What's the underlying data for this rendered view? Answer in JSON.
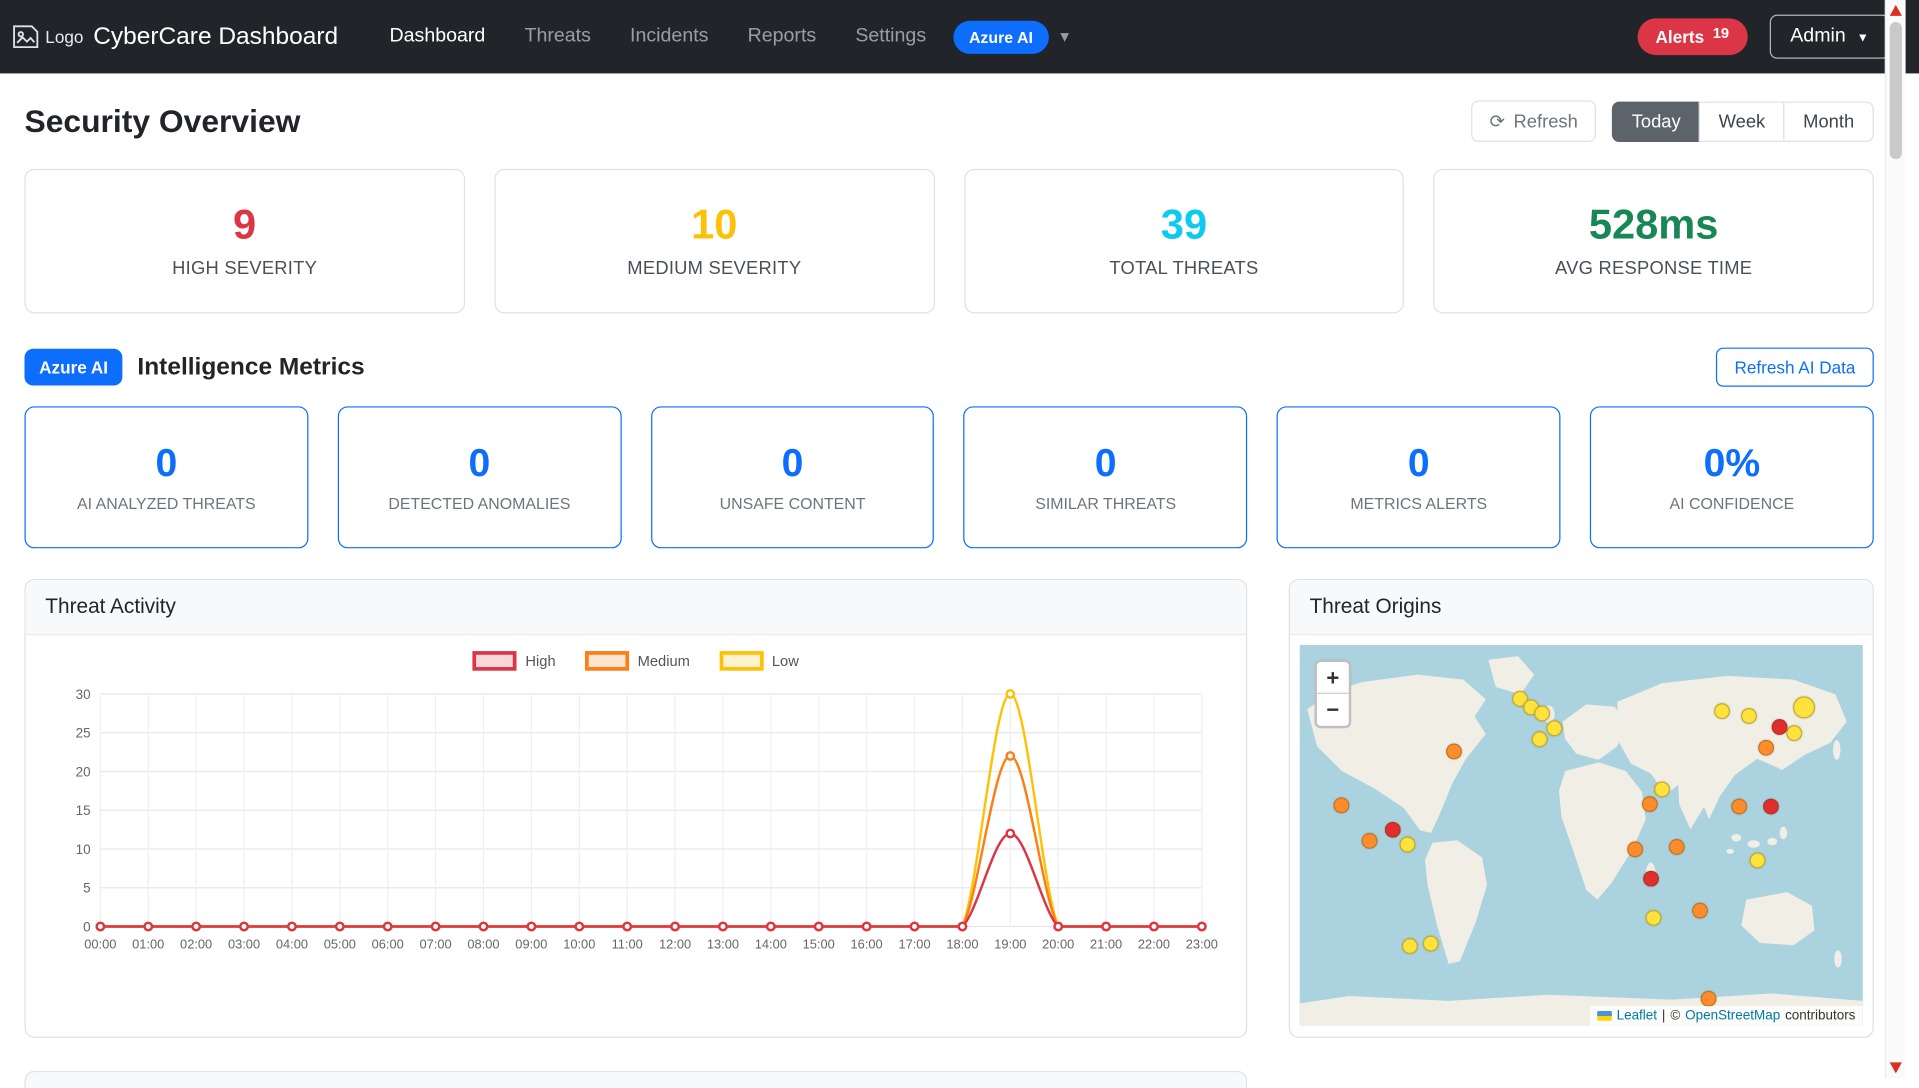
{
  "navbar": {
    "logo_text": "Logo",
    "brand": "CyberCare Dashboard",
    "items": [
      {
        "label": "Dashboard",
        "active": true
      },
      {
        "label": "Threats",
        "active": false
      },
      {
        "label": "Incidents",
        "active": false
      },
      {
        "label": "Reports",
        "active": false
      },
      {
        "label": "Settings",
        "active": false
      }
    ],
    "azure_badge": "Azure AI",
    "alerts": {
      "label": "Alerts",
      "count": "19"
    },
    "admin_label": "Admin"
  },
  "icons": {
    "refresh": "⟳",
    "caret_small": "▼",
    "caret_nav": "▼"
  },
  "page": {
    "title": "Security Overview",
    "refresh_label": "Refresh",
    "ranges": [
      {
        "label": "Today",
        "active": true
      },
      {
        "label": "Week",
        "active": false
      },
      {
        "label": "Month",
        "active": false
      }
    ]
  },
  "stats": [
    {
      "value": "9",
      "label": "HIGH SEVERITY",
      "color": "#dc3545"
    },
    {
      "value": "10",
      "label": "MEDIUM SEVERITY",
      "color": "#ffc107"
    },
    {
      "value": "39",
      "label": "TOTAL THREATS",
      "color": "#0dcaf0"
    },
    {
      "value": "528ms",
      "label": "AVG RESPONSE TIME",
      "color": "#198754"
    }
  ],
  "ai": {
    "badge": "Azure AI",
    "title": "Intelligence Metrics",
    "refresh_label": "Refresh AI Data",
    "accent": "#0d6efd",
    "metrics": [
      {
        "value": "0",
        "label": "AI ANALYZED THREATS"
      },
      {
        "value": "0",
        "label": "DETECTED ANOMALIES"
      },
      {
        "value": "0",
        "label": "UNSAFE CONTENT"
      },
      {
        "value": "0",
        "label": "SIMILAR THREATS"
      },
      {
        "value": "0",
        "label": "METRICS ALERTS"
      },
      {
        "value": "0%",
        "label": "AI CONFIDENCE"
      }
    ]
  },
  "activity_card": {
    "title": "Threat Activity"
  },
  "chart_data": {
    "type": "line",
    "x": [
      "00:00",
      "01:00",
      "02:00",
      "03:00",
      "04:00",
      "05:00",
      "06:00",
      "07:00",
      "08:00",
      "09:00",
      "10:00",
      "11:00",
      "12:00",
      "13:00",
      "14:00",
      "15:00",
      "16:00",
      "17:00",
      "18:00",
      "19:00",
      "20:00",
      "21:00",
      "22:00",
      "23:00"
    ],
    "series": [
      {
        "name": "High",
        "color": "#dc3545",
        "values": [
          0,
          0,
          0,
          0,
          0,
          0,
          0,
          0,
          0,
          0,
          0,
          0,
          0,
          0,
          0,
          0,
          0,
          0,
          0,
          12,
          0,
          0,
          0,
          0
        ]
      },
      {
        "name": "Medium",
        "color": "#fd7e14",
        "values": [
          0,
          0,
          0,
          0,
          0,
          0,
          0,
          0,
          0,
          0,
          0,
          0,
          0,
          0,
          0,
          0,
          0,
          0,
          0,
          22,
          0,
          0,
          0,
          0
        ]
      },
      {
        "name": "Low",
        "color": "#ffc107",
        "values": [
          0,
          0,
          0,
          0,
          0,
          0,
          0,
          0,
          0,
          0,
          0,
          0,
          0,
          0,
          0,
          0,
          0,
          0,
          0,
          30,
          0,
          0,
          0,
          0
        ]
      }
    ],
    "ylim": [
      0,
      30
    ],
    "yticks": [
      0,
      5,
      10,
      15,
      20,
      25,
      30
    ],
    "legend_position": "top",
    "grid": true
  },
  "map_card": {
    "title": "Threat Origins",
    "zoom_in": "+",
    "zoom_out": "−",
    "attribution": {
      "leaflet": "Leaflet",
      "sep": "|",
      "copy": "©",
      "osm": "OpenStreetMap",
      "suffix": "contributors"
    },
    "marker_colors": {
      "red": "#e12d2d",
      "orange": "#fd8d2c",
      "yellow": "#ffe23c"
    },
    "markers": [
      {
        "x": 39.2,
        "y": 14.3,
        "c": "yellow"
      },
      {
        "x": 41.0,
        "y": 16.5,
        "c": "yellow"
      },
      {
        "x": 43.0,
        "y": 18.0,
        "c": "yellow"
      },
      {
        "x": 45.2,
        "y": 22.0,
        "c": "yellow"
      },
      {
        "x": 42.5,
        "y": 24.7,
        "c": "yellow"
      },
      {
        "x": 74.9,
        "y": 17.5,
        "c": "yellow"
      },
      {
        "x": 79.7,
        "y": 18.5,
        "c": "yellow"
      },
      {
        "x": 89.6,
        "y": 16.5,
        "c": "yellow",
        "big": true
      },
      {
        "x": 87.9,
        "y": 23.0,
        "c": "yellow"
      },
      {
        "x": 85.2,
        "y": 21.4,
        "c": "red"
      },
      {
        "x": 82.8,
        "y": 26.9,
        "c": "orange"
      },
      {
        "x": 27.3,
        "y": 27.9,
        "c": "orange"
      },
      {
        "x": 7.3,
        "y": 42.2,
        "c": "orange"
      },
      {
        "x": 16.5,
        "y": 48.4,
        "c": "red"
      },
      {
        "x": 12.3,
        "y": 51.6,
        "c": "orange"
      },
      {
        "x": 19.2,
        "y": 52.3,
        "c": "yellow"
      },
      {
        "x": 64.3,
        "y": 38.0,
        "c": "yellow"
      },
      {
        "x": 62.1,
        "y": 41.9,
        "c": "orange"
      },
      {
        "x": 78.0,
        "y": 42.5,
        "c": "orange"
      },
      {
        "x": 83.7,
        "y": 42.5,
        "c": "red"
      },
      {
        "x": 59.5,
        "y": 53.6,
        "c": "orange"
      },
      {
        "x": 67.0,
        "y": 52.9,
        "c": "orange"
      },
      {
        "x": 62.3,
        "y": 61.4,
        "c": "red"
      },
      {
        "x": 81.3,
        "y": 56.5,
        "c": "yellow"
      },
      {
        "x": 62.8,
        "y": 71.8,
        "c": "yellow"
      },
      {
        "x": 71.1,
        "y": 69.8,
        "c": "orange"
      },
      {
        "x": 19.6,
        "y": 79.2,
        "c": "yellow"
      },
      {
        "x": 23.3,
        "y": 78.6,
        "c": "yellow"
      },
      {
        "x": 72.7,
        "y": 92.9,
        "c": "orange"
      }
    ]
  }
}
